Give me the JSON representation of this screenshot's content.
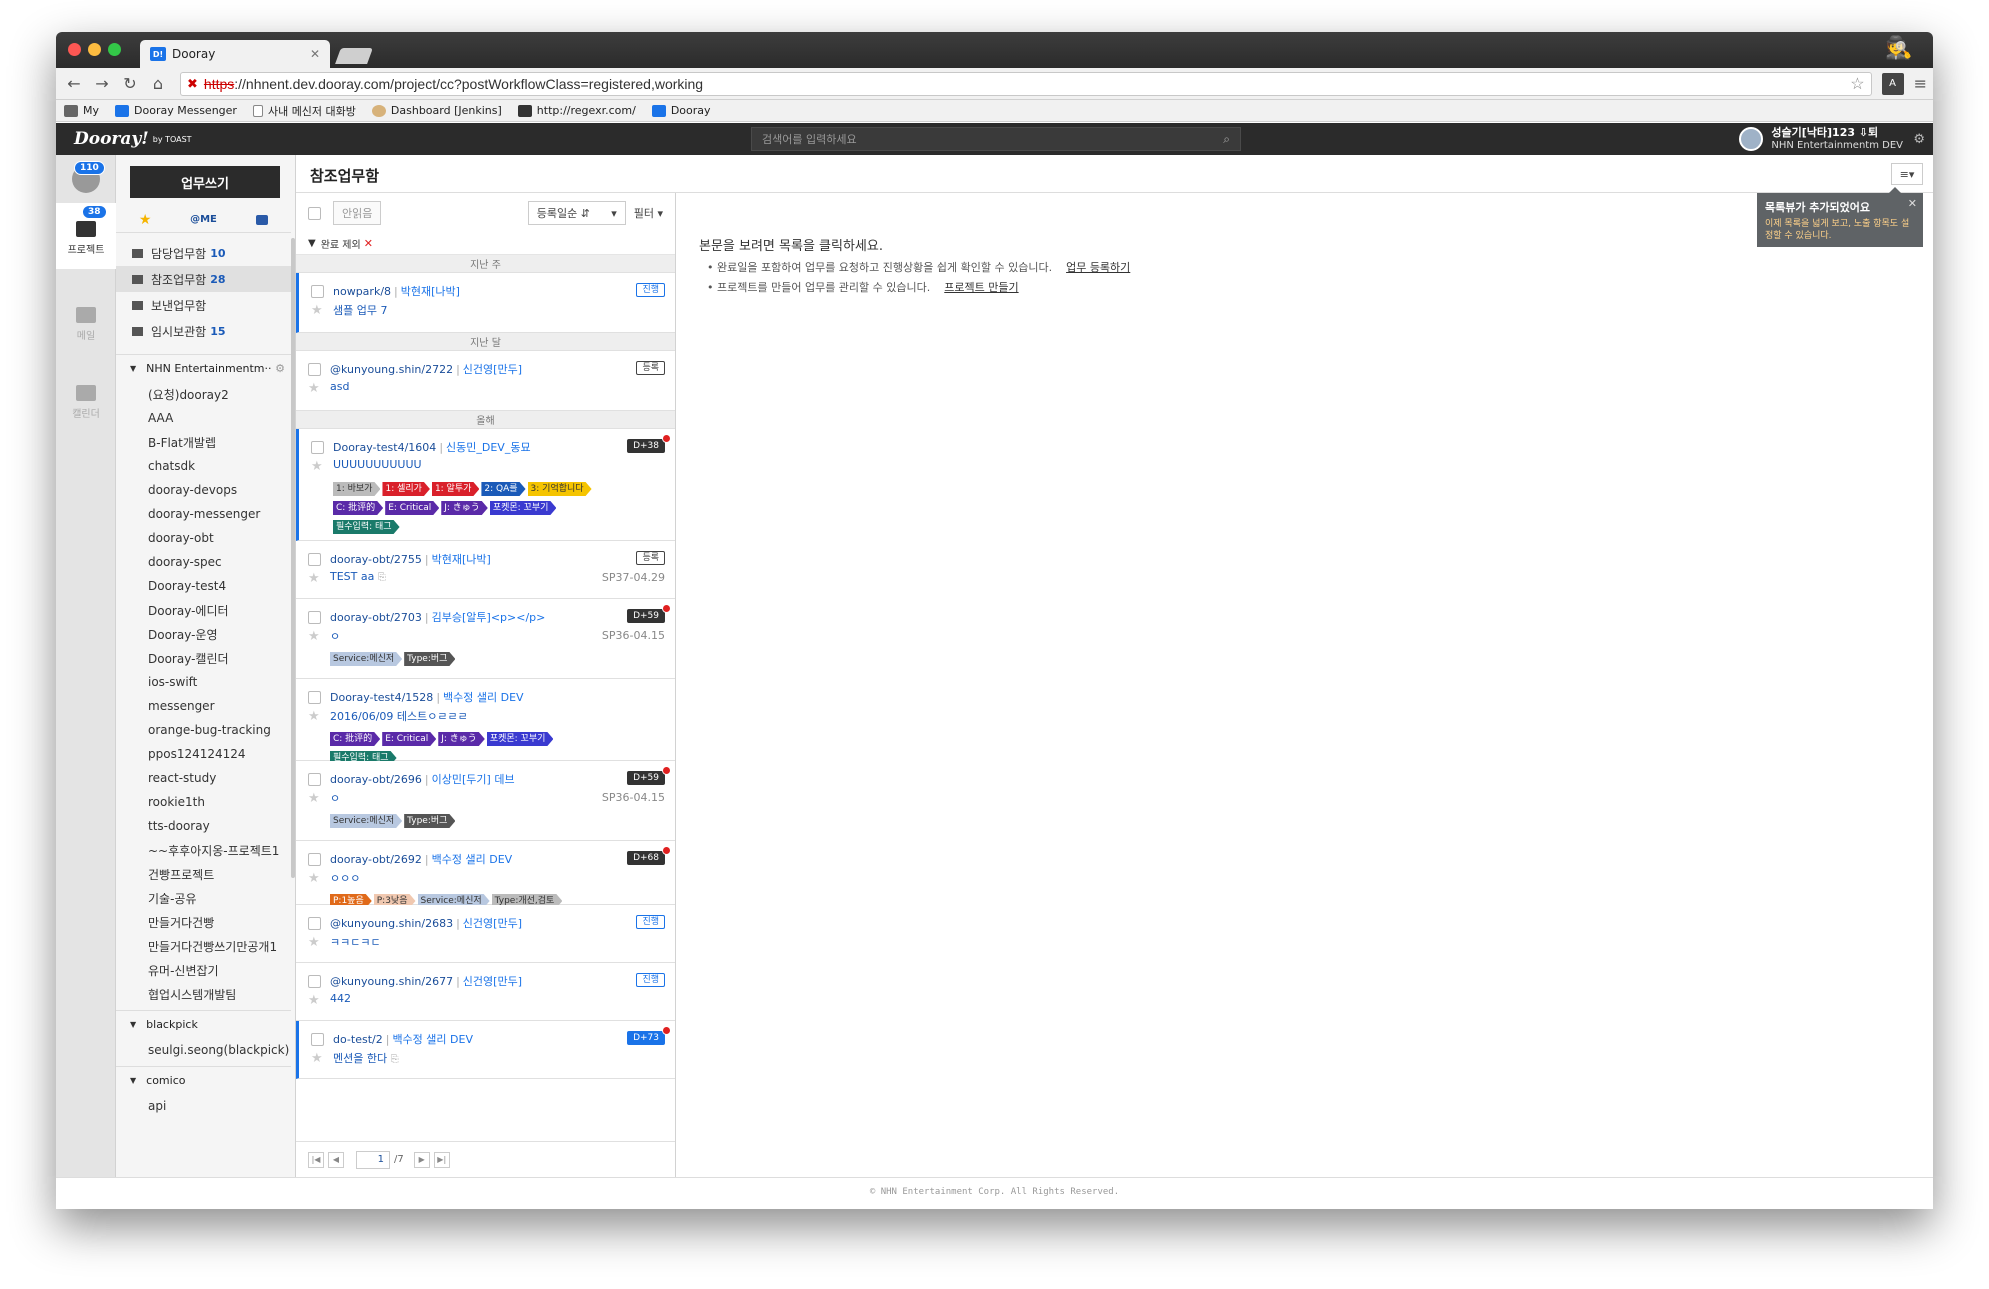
{
  "browser": {
    "tab_title": "Dooray",
    "favicon_text": "D!",
    "url_scheme": "https",
    "url_rest": "://nhnent.dev.dooray.com/project/cc?postWorkflowClass=registered,working",
    "ext_label": "A",
    "bookmarks": [
      "My",
      "Dooray Messenger",
      "사내 메신저 대화방",
      "Dashboard [Jenkins]",
      "http://regexr.com/",
      "Dooray"
    ]
  },
  "app": {
    "logo": "Dooray!",
    "logo_by": "by TOAST",
    "search_placeholder": "검색어를 입력하세요",
    "user_name": "성슬기[낙타]123 ⇩퇴",
    "user_org": "NHN Entertainmentm DEV"
  },
  "rail": {
    "badge_top": "110",
    "badge_project": "38",
    "project_label": "프로젝트",
    "mail_label": "메일",
    "calendar_label": "캘린더"
  },
  "sidebar": {
    "write_button": "업무쓰기",
    "tab_me": "@ME",
    "folders": [
      {
        "label": "담당업무함",
        "count": "10"
      },
      {
        "label": "참조업무함",
        "count": "28"
      },
      {
        "label": "보낸업무함",
        "count": ""
      },
      {
        "label": "임시보관함",
        "count": "15"
      }
    ],
    "group1": "NHN Entertainmentm··",
    "projects1": [
      "(요청)dooray2",
      "AAA",
      "B-Flat개발렙",
      "chatsdk",
      "dooray-devops",
      "dooray-messenger",
      "dooray-obt",
      "dooray-spec",
      "Dooray-test4",
      "Dooray-에디터",
      "Dooray-운영",
      "Dooray-캘린더",
      "ios-swift",
      "messenger",
      "orange-bug-tracking",
      "ppos124124124",
      "react-study",
      "rookie1th",
      "tts-dooray",
      "~~후후아지옹-프로젝트1",
      "건빵프로젝트",
      "기술-공유",
      "만들거다건빵",
      "만들거다건빵쓰기만공개1",
      "유머-신변잡기",
      "협업시스템개발팀"
    ],
    "group2": "blackpick",
    "projects2": [
      "seulgi.seong(blackpick)"
    ],
    "group3": "comico",
    "projects3": [
      "api"
    ]
  },
  "content": {
    "title": "참조업무함",
    "view_icon": "≡▾"
  },
  "list": {
    "unread_button": "안읽음",
    "sort_label": "등록일순 ⇵",
    "filter_label": "필터",
    "filter_applied": "완료 제외",
    "section_week": "지난 주",
    "section_month": "지난 달",
    "section_year": "올해",
    "items": [
      {
        "id": "nowpark/8",
        "user": "박현재[나박]",
        "title": "샘플 업무 7",
        "badge": "진행"
      },
      {
        "id": "@kunyoung.shin/2722",
        "user": "신건영[만두]",
        "title": "asd",
        "badge": "등록"
      },
      {
        "id": "Dooray-test4/1604",
        "user": "신동민_DEV_동묘",
        "title": "UUUUUUUUUUU",
        "badge": "D+38"
      },
      {
        "id": "dooray-obt/2755",
        "user": "박현재[나박]",
        "title": "TEST aa",
        "badge": "등록",
        "milestone": "SP37-04.29"
      },
      {
        "id": "dooray-obt/2703",
        "user": "김부승[알투]<p></p>",
        "title": "ㅇ",
        "badge": "D+59",
        "milestone": "SP36-04.15"
      },
      {
        "id": "Dooray-test4/1528",
        "user": "백수정 샐리 DEV",
        "title": "2016/06/09 테스트ㅇㄹㄹㄹ",
        "badge": ""
      },
      {
        "id": "dooray-obt/2696",
        "user": "이상민[두기] 데브",
        "title": "ㅇ",
        "badge": "D+59",
        "milestone": "SP36-04.15"
      },
      {
        "id": "dooray-obt/2692",
        "user": "백수정 샐리 DEV",
        "title": "ㅇㅇㅇ",
        "badge": "D+68"
      },
      {
        "id": "@kunyoung.shin/2683",
        "user": "신건영[만두]",
        "title": "ㅋㅋㄷㅋㄷ",
        "badge": "진행"
      },
      {
        "id": "@kunyoung.shin/2677",
        "user": "신건영[만두]",
        "title": "442",
        "badge": "진행"
      },
      {
        "id": "do-test/2",
        "user": "백수정 샐리 DEV",
        "title": "멘션을 한다",
        "badge": "D+73"
      }
    ],
    "tags": {
      "t1": "1: 바보가",
      "t2": "1: 셀리가",
      "t3": "1: 알투가",
      "t4": "2: QA를",
      "t5": "3: 기억합니다",
      "c": "C: 批评的",
      "e": "E: Critical",
      "j": "J: きゅう",
      "k": "포켓몬: 꼬부기",
      "req": "필수입력: 태그",
      "svc": "Service:메신저",
      "type_bug": "Type:버그",
      "p1": "P:1높음",
      "p3": "P:3낮음",
      "type_rev": "Type:개선,검토"
    },
    "page_current": "1",
    "page_total": "/7"
  },
  "detail": {
    "prompt": "본문을 보려면 목록을 클릭하세요.",
    "line1": "완료일을 포함하여 업무를 요청하고 진행상황을 쉽게 확인할 수 있습니다.",
    "link1": "업무 등록하기",
    "line2": "프로젝트를 만들어 업무를 관리할 수 있습니다.",
    "link2": "프로젝트 만들기",
    "tooltip_title": "목록뷰가 추가되었어요",
    "tooltip_body": "이제 목록을 넓게 보고, 노출 항목도 설정할 수 있습니다."
  },
  "footer": "© NHN Entertainment Corp. All Rights Reserved.",
  "colors": {
    "accent": "#1a73e8",
    "dark": "#2b2b2b",
    "danger": "#e02020"
  }
}
